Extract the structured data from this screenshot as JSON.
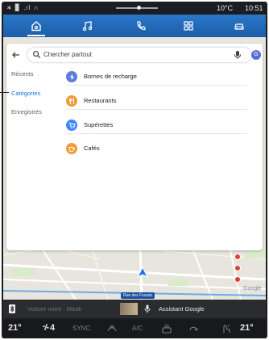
{
  "status": {
    "left_icons": "∗ ▊ .ıl ∩",
    "temperature": "10°C",
    "time": "10:51"
  },
  "topnav": {
    "items": [
      {
        "id": "home",
        "icon": "home-icon",
        "active": true
      },
      {
        "id": "music",
        "icon": "music-note-icon"
      },
      {
        "id": "phone",
        "icon": "phone-icon"
      },
      {
        "id": "apps",
        "icon": "apps-grid-icon"
      },
      {
        "id": "car",
        "icon": "car-icon"
      }
    ],
    "accent": "#2a77c9"
  },
  "search": {
    "placeholder": "Chercher partout",
    "avatar_initial": "G"
  },
  "sidebar": {
    "tabs": [
      {
        "label": "Récents",
        "active": false
      },
      {
        "label": "Catégories",
        "active": true
      },
      {
        "label": "Enregistrés",
        "active": false
      }
    ]
  },
  "categories": [
    {
      "label": "Bornes de recharge",
      "icon": "charging-station-icon",
      "color": "#5e7cdf"
    },
    {
      "label": "Restaurants",
      "icon": "restaurant-icon",
      "color": "#f29b38"
    },
    {
      "label": "Supérettes",
      "icon": "shopping-cart-icon",
      "color": "#4285f4"
    },
    {
      "label": "Cafés",
      "icon": "coffee-cup-icon",
      "color": "#f29b38"
    }
  ],
  "map": {
    "street_label": "Rue des Fossés",
    "logo": "Google"
  },
  "media": {
    "source_text": "Voiture noire · Meak",
    "assistant_label": "Assistant Google"
  },
  "climate": {
    "temp_left": "21°",
    "fan_speed": "4",
    "sync_label": "SYNC",
    "ac_label": "A/C",
    "temp_right": "21°"
  }
}
